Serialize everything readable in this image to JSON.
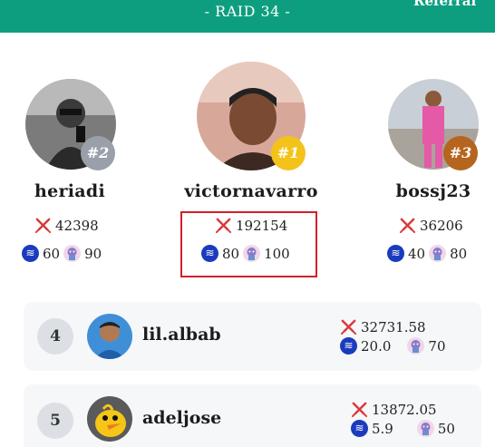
{
  "header": {
    "title": "- RAID 34 -",
    "referral_label": "Referral",
    "accent_color": "#0d9e7f"
  },
  "podium": [
    {
      "rank": "#2",
      "name": "heriadi",
      "damage": "42398",
      "steem": "60",
      "pet": "90",
      "badge_color": "#9aa0aa"
    },
    {
      "rank": "#1",
      "name": "victornavarro",
      "damage": "192154",
      "steem": "80",
      "pet": "100",
      "badge_color": "#f4c31a",
      "highlighted": true
    },
    {
      "rank": "#3",
      "name": "bossj23",
      "damage": "36206",
      "steem": "40",
      "pet": "80",
      "badge_color": "#b5651d"
    }
  ],
  "rows": [
    {
      "rank": "4",
      "name": "lil.albab",
      "damage": "32731.58",
      "steem": "20.0",
      "pet": "70"
    },
    {
      "rank": "5",
      "name": "adeljose",
      "damage": "13872.05",
      "steem": "5.9",
      "pet": "50"
    }
  ],
  "icons": {
    "damage": "crossed-swords-icon",
    "steem": "steem-coin-icon",
    "pet": "pet-icon"
  }
}
